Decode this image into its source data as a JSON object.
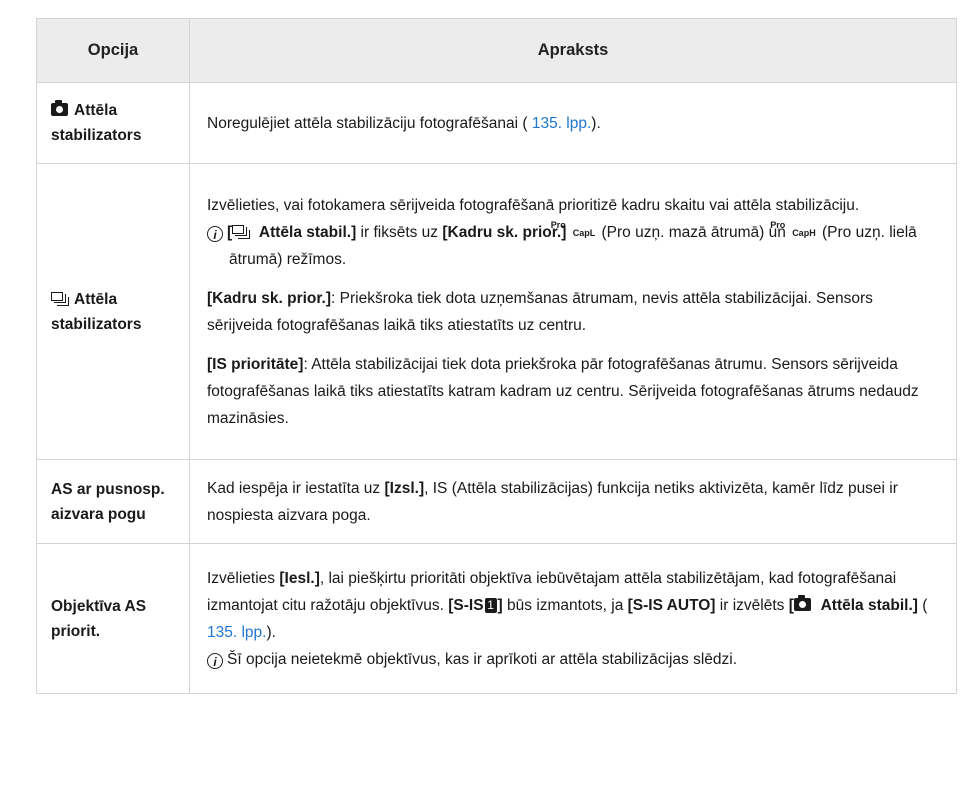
{
  "header": {
    "col_option": "Opcija",
    "col_description": "Apraksts"
  },
  "rows": [
    {
      "option": "Attēla stabilizators",
      "desc": {
        "text": "Noregulējiet attēla stabilizāciju fotografēšanai ( ",
        "link": "135. lpp.",
        "after": ")."
      }
    },
    {
      "option": "Attēla stabilizators",
      "intro": "Izvēlieties, vai fotokamera sērijveida fotografēšanā prioritizē kadru skaitu vai attēla stabilizāciju.",
      "note": {
        "prefix": "[",
        "bold": " Attēla stabil.]",
        "t1": " ir fiksēts uz ",
        "bold2": "[Kadru sk. prior.]",
        "pro_top": "Pro",
        "capl": "CapL",
        "t2": " (Pro uzņ. mazā ātrumā) un ",
        "caph": "CapH",
        "t3": " (Pro uzņ. lielā ātrumā) režīmos."
      },
      "p1": {
        "bold": "[Kadru sk. prior.]",
        "text": ": Priekšroka tiek dota uzņemšanas ātrumam, nevis attēla stabilizācijai. Sensors sērijveida fotografēšanas laikā tiks atiestatīts uz centru."
      },
      "p2": {
        "bold": "[IS prioritāte]",
        "text": ": Attēla stabilizācijai tiek dota priekšroka pār fotografēšanas ātrumu. Sensors sērijveida fotografēšanas laikā tiks atiestatīts katram kadram uz centru. Sērijveida fotografēšanas ātrums nedaudz mazināsies."
      }
    },
    {
      "option": "AS ar pusnosp. aizvara pogu",
      "desc": {
        "t1": "Kad iespēja ir iestatīta uz ",
        "bold": "[Izsl.]",
        "t2": ", IS (Attēla stabilizācijas) funkcija netiks aktivizēta, kamēr līdz pusei ir nospiesta aizvara poga."
      }
    },
    {
      "option": "Objektīva AS priorit.",
      "t1": "Izvēlieties ",
      "b1": "[Iesl.]",
      "t2": ", lai piešķirtu prioritāti objektīva iebūvētajam attēla stabilizētājam, kad fotografēšanai izmantojat citu ražotāju objektīvus. ",
      "b2a": "[S-IS",
      "num": "1",
      "b2b": "]",
      "t3": " būs izmantots, ja ",
      "b3": "[S-IS AUTO]",
      "t4": " ir izvēlēts ",
      "b4a": "[",
      "b4b": " Attēla stabil.]",
      "t5": " ( ",
      "link": "135. lpp.",
      "t6": ").",
      "note": "Šī opcija neietekmē objektīvus, kas ir aprīkoti ar attēla stabilizācijas slēdzi."
    }
  ],
  "icons": {
    "still": "camera-icon",
    "sequential": "sequential-shooting-icon",
    "note": "note-icon",
    "pro_capture": "pro-capture-icon"
  }
}
